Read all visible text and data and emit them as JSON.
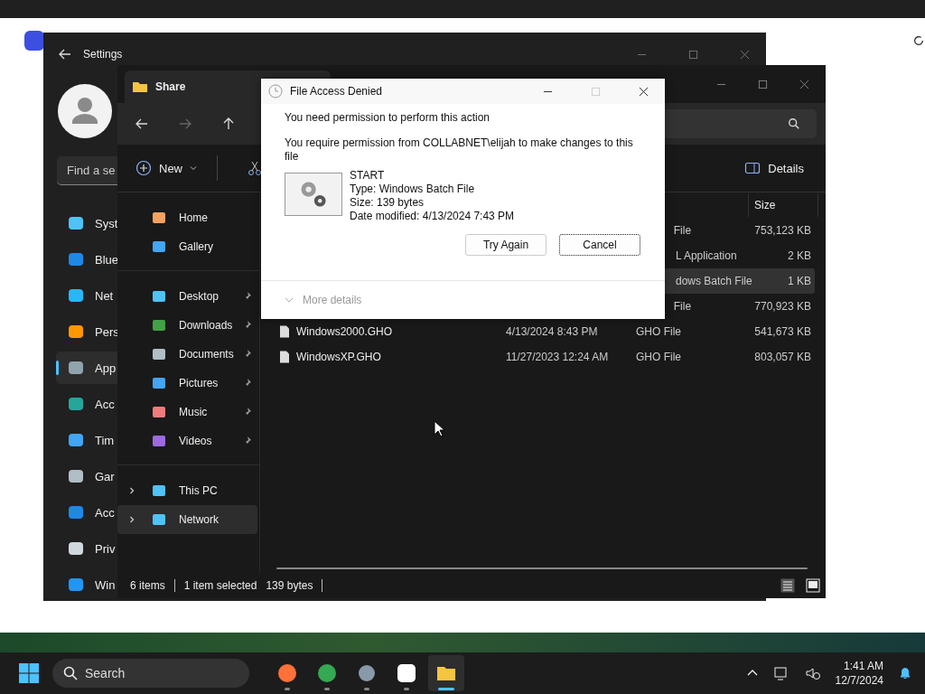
{
  "settings": {
    "title": "Settings",
    "search": {
      "placeholder": "Find a se"
    },
    "nav": [
      {
        "label": "Syst",
        "selected": false
      },
      {
        "label": "Blue",
        "selected": false
      },
      {
        "label": "Net",
        "selected": false
      },
      {
        "label": "Pers",
        "selected": false
      },
      {
        "label": "App",
        "selected": true
      },
      {
        "label": "Acc",
        "selected": false
      },
      {
        "label": "Tim",
        "selected": false
      },
      {
        "label": "Gar",
        "selected": false
      },
      {
        "label": "Acc",
        "selected": false
      },
      {
        "label": "Priv",
        "selected": false
      },
      {
        "label": "Win",
        "selected": false
      }
    ]
  },
  "explorer": {
    "title": "Share",
    "toolbar": {
      "new": "New",
      "details": "Details"
    },
    "nav_groups": [
      [
        {
          "label": "Home",
          "pinned": false,
          "expandable": false,
          "selected": false
        },
        {
          "label": "Gallery",
          "pinned": false,
          "expandable": false,
          "selected": false
        }
      ],
      [
        {
          "label": "Desktop",
          "pinned": true,
          "expandable": false,
          "selected": false
        },
        {
          "label": "Downloads",
          "pinned": true,
          "expandable": false,
          "selected": false
        },
        {
          "label": "Documents",
          "pinned": true,
          "expandable": false,
          "selected": false
        },
        {
          "label": "Pictures",
          "pinned": true,
          "expandable": false,
          "selected": false
        },
        {
          "label": "Music",
          "pinned": true,
          "expandable": false,
          "selected": false
        },
        {
          "label": "Videos",
          "pinned": true,
          "expandable": false,
          "selected": false
        }
      ],
      [
        {
          "label": "This PC",
          "pinned": false,
          "expandable": true,
          "selected": false
        },
        {
          "label": "Network",
          "pinned": false,
          "expandable": true,
          "selected": true
        }
      ]
    ],
    "columns": {
      "size": "Size"
    },
    "rows": [
      {
        "type": "File",
        "size": "753,123 KB",
        "selected": false
      },
      {
        "type": "L Application",
        "size": "2 KB",
        "selected": false
      },
      {
        "type": "dows Batch File",
        "size": "1 KB",
        "selected": true
      },
      {
        "type": "File",
        "size": "770,923 KB",
        "selected": false
      },
      {
        "name": "Windows2000.GHO",
        "date": "4/13/2024 8:43 PM",
        "type": "GHO File",
        "size": "541,673 KB",
        "selected": false
      },
      {
        "name": "WindowsXP.GHO",
        "date": "11/27/2023 12:24 AM",
        "type": "GHO File",
        "size": "803,057 KB",
        "selected": false
      }
    ],
    "status": [
      "6 items",
      "1 item selected",
      "139 bytes"
    ]
  },
  "dialog": {
    "title": "File Access Denied",
    "heading": "You need permission to perform this action",
    "message": "You require permission from COLLABNET\\elijah to make changes to this file",
    "file": {
      "name": "START",
      "type": "Type: Windows Batch File",
      "size": "Size: 139 bytes",
      "date": "Date modified: 4/13/2024 7:43 PM"
    },
    "buttons": [
      {
        "label": "Try Again",
        "default": false
      },
      {
        "label": "Cancel",
        "default": true
      }
    ],
    "more": "More details"
  },
  "taskbar": {
    "search": {
      "placeholder": "Search"
    },
    "apps": [
      {
        "active": false
      },
      {
        "active": false
      },
      {
        "active": false
      },
      {
        "active": false
      },
      {
        "active": true
      }
    ],
    "time": "1:41 AM",
    "date": "12/7/2024"
  }
}
